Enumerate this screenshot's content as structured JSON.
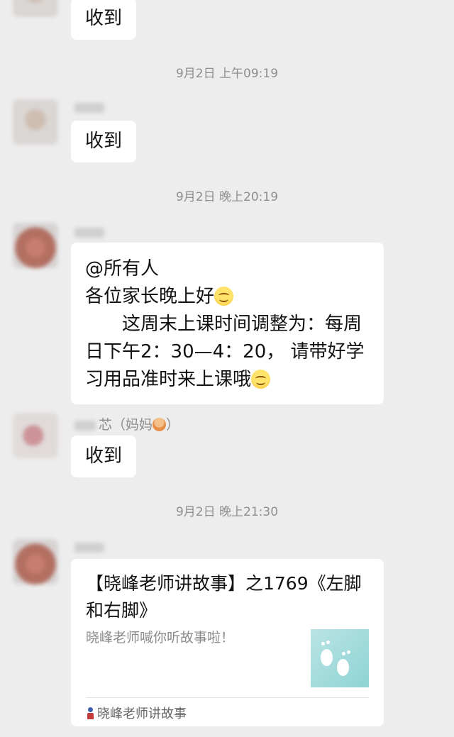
{
  "messages": {
    "m1": "收到",
    "m2": "收到",
    "m3_line1": "@所有人",
    "m3_line2": "各位家长晚上好",
    "m3_line3": "这周末上课时间调整为：每周",
    "m3_line4": "日下午2：30—4：20， 请带好学",
    "m3_line5": "习用品准时来上课哦",
    "m4": "收到"
  },
  "timestamps": {
    "t1": "9月2日 上午09:19",
    "t2": "9月2日 晚上20:19",
    "t3": "9月2日 晚上21:30"
  },
  "senders": {
    "s3_suffix": "芯（妈妈",
    "s3_end": "）"
  },
  "card": {
    "title": "【晓峰老师讲故事】之1769《左脚和右脚》",
    "description": "晓峰老师喊你听故事啦！",
    "source": "晓峰老师讲故事"
  },
  "icons": {
    "smile": "smiling-face-emoji",
    "woman": "woman-emoji",
    "footprints": "footprints-thumbnail",
    "source": "person-icon"
  }
}
